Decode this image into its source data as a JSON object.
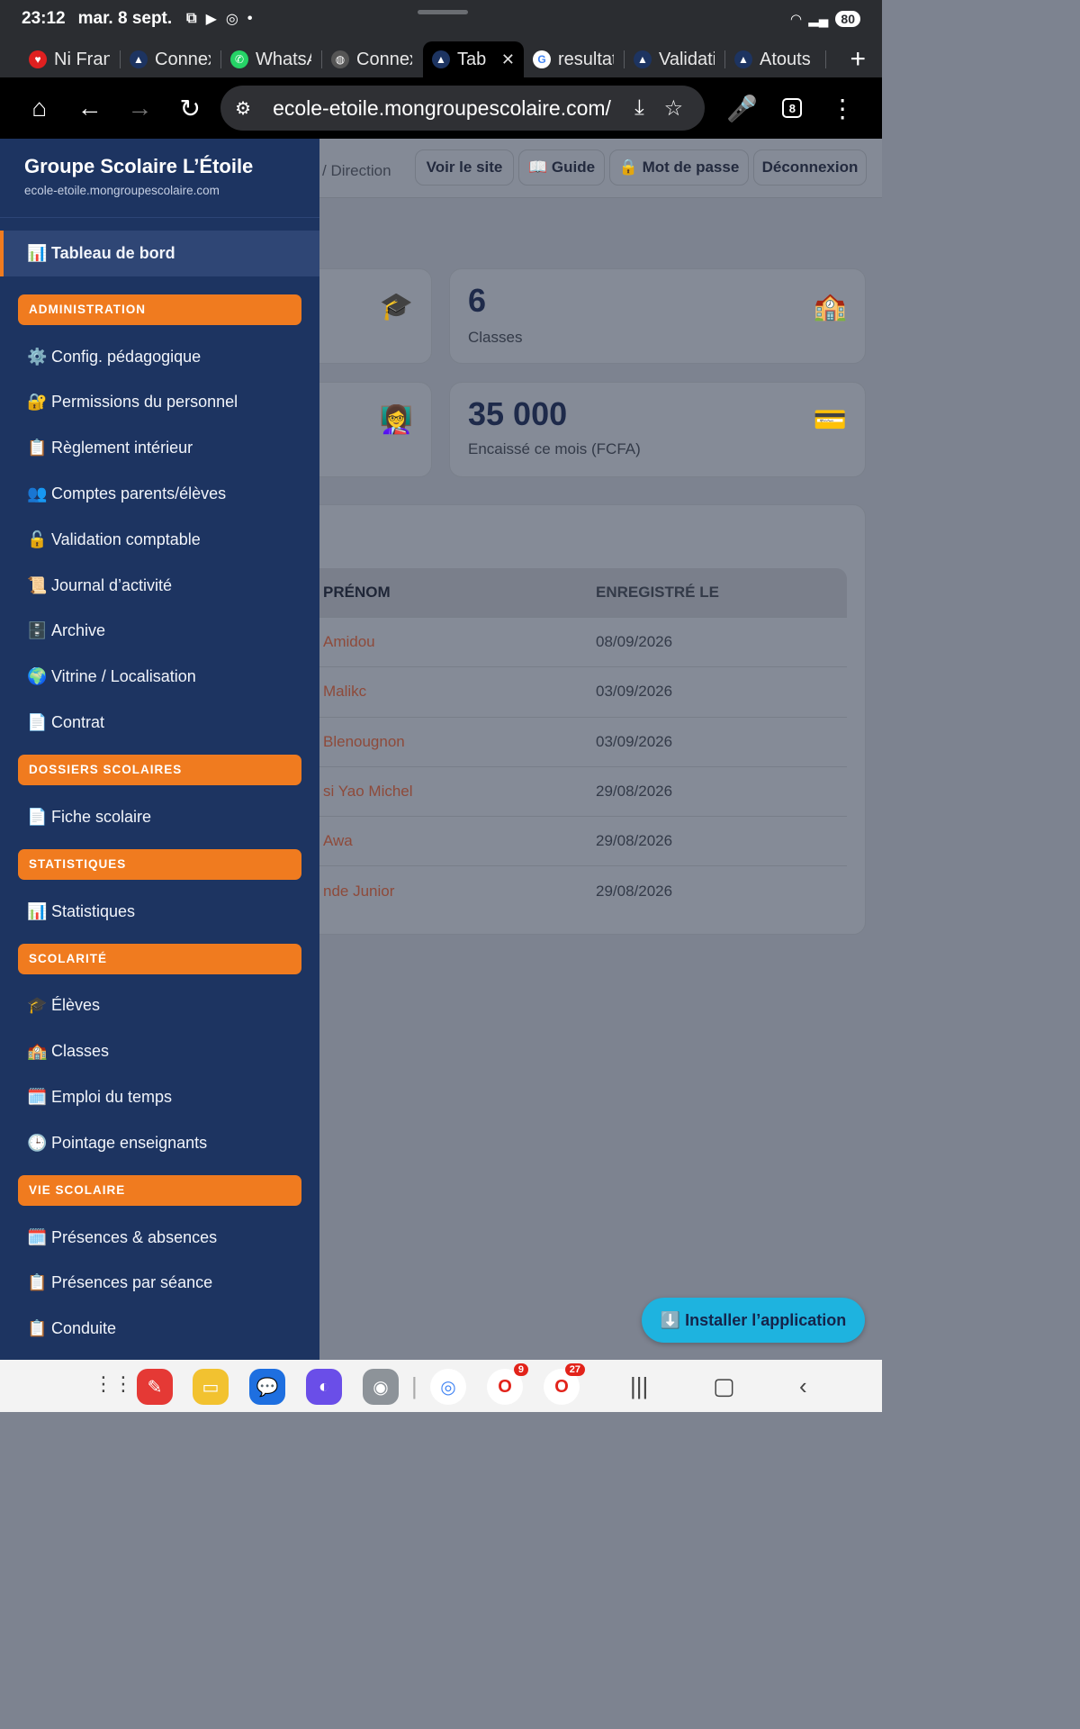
{
  "status_bar": {
    "time": "23:12",
    "date": "mar. 8 sept.",
    "battery": "80"
  },
  "tabs": [
    {
      "label": "Ni Franc",
      "icon_color": "#e02020",
      "icon": "heart-icon"
    },
    {
      "label": "Connexion",
      "icon_color": "#1d3461",
      "icon": "school-logo-icon"
    },
    {
      "label": "WhatsApp",
      "icon_color": "#25d366",
      "icon": "whatsapp-icon"
    },
    {
      "label": "Connexion",
      "icon_color": "#2b2d31",
      "icon": "globe-icon"
    },
    {
      "label": "Tableau",
      "icon_color": "#1d3461",
      "icon": "school-logo-icon",
      "active": true
    },
    {
      "label": "resultats",
      "icon_color": "#ffffff",
      "icon": "google-icon"
    },
    {
      "label": "Validation",
      "icon_color": "#1d3461",
      "icon": "school-logo-icon"
    },
    {
      "label": "Atouts",
      "icon_color": "#1d3461",
      "icon": "school-logo-icon"
    }
  ],
  "toolbar": {
    "url": "ecole-etoile.mongroupescolaire.com/",
    "tab_count": "8"
  },
  "header": {
    "breadcrumb": "/ Direction",
    "buttons": {
      "site": "Voir le site",
      "guide": "📖 Guide",
      "password": "🔒 Mot de passe",
      "logout": "Déconnexion"
    }
  },
  "stats": {
    "classes": {
      "value": "6",
      "label": "Classes",
      "icon": "🏫"
    },
    "cashed": {
      "value": "35 000",
      "label": "Encaissé ce mois (FCFA)",
      "icon": "💳"
    },
    "icon_students": "🎓",
    "icon_teachers": "👩‍🏫"
  },
  "table": {
    "headers": [
      "PRÉNOM",
      "ENREGISTRÉ LE"
    ],
    "rows": [
      [
        "Amidou",
        "08/09/2026"
      ],
      [
        "Malikc",
        "03/09/2026"
      ],
      [
        "Blenougnon",
        "03/09/2026"
      ],
      [
        "si Yao Michel",
        "29/08/2026"
      ],
      [
        "Awa",
        "29/08/2026"
      ],
      [
        "nde Junior",
        "29/08/2026"
      ]
    ]
  },
  "install_button": "⬇️ Installer l’application",
  "sidebar": {
    "brand": "Groupe Scolaire L’Étoile",
    "domain": "ecole-etoile.mongroupescolaire.com",
    "dashboard": {
      "icon": "📊",
      "label": "Tableau de bord"
    },
    "sections": [
      {
        "title": "ADMINISTRATION",
        "items": [
          {
            "icon": "⚙️",
            "label": "Config. pédagogique"
          },
          {
            "icon": "🔐",
            "label": "Permissions du personnel"
          },
          {
            "icon": "📋",
            "label": "Règlement intérieur"
          },
          {
            "icon": "👥",
            "label": "Comptes parents/élèves"
          },
          {
            "icon": "🔓",
            "label": "Validation comptable"
          },
          {
            "icon": "📜",
            "label": "Journal d’activité"
          },
          {
            "icon": "🗄️",
            "label": "Archive"
          },
          {
            "icon": "🌍",
            "label": "Vitrine / Localisation"
          },
          {
            "icon": "📄",
            "label": "Contrat"
          }
        ]
      },
      {
        "title": "DOSSIERS SCOLAIRES",
        "items": [
          {
            "icon": "📄",
            "label": "Fiche scolaire"
          }
        ]
      },
      {
        "title": "STATISTIQUES",
        "items": [
          {
            "icon": "📊",
            "label": "Statistiques"
          }
        ]
      },
      {
        "title": "SCOLARITÉ",
        "items": [
          {
            "icon": "🎓",
            "label": "Élèves"
          },
          {
            "icon": "🏫",
            "label": "Classes"
          },
          {
            "icon": "🗓️",
            "label": "Emploi du temps"
          },
          {
            "icon": "🕒",
            "label": "Pointage enseignants"
          }
        ]
      },
      {
        "title": "VIE SCOLAIRE",
        "items": [
          {
            "icon": "🗓️",
            "label": "Présences & absences"
          },
          {
            "icon": "📋",
            "label": "Présences par séance"
          },
          {
            "icon": "📋",
            "label": "Conduite"
          }
        ]
      }
    ]
  },
  "navbar": {
    "badges": {
      "opera_mini": "9",
      "opera": "27"
    }
  }
}
